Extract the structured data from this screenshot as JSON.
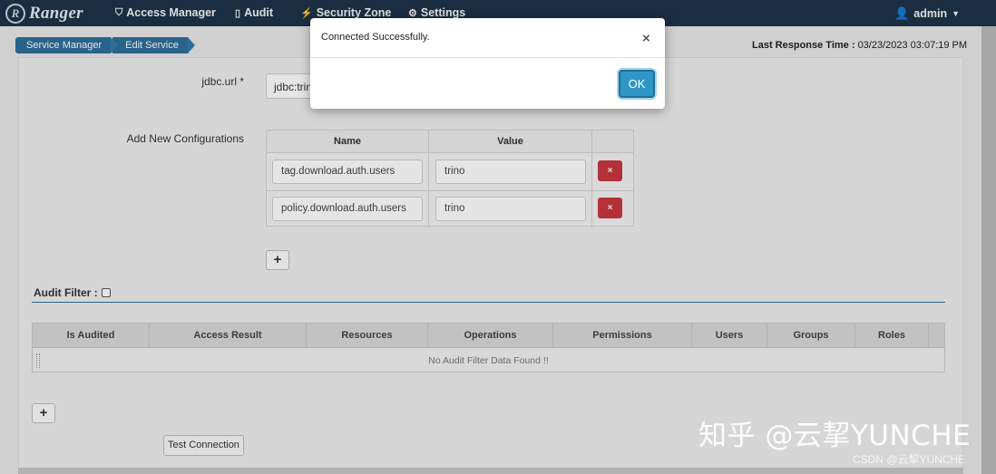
{
  "navbar": {
    "brand": "Ranger",
    "brand_logo": "R",
    "items": [
      {
        "label": "Access Manager",
        "icon": "shield-icon"
      },
      {
        "label": "Audit",
        "icon": "file-icon"
      },
      {
        "label": "Security Zone",
        "icon": "bolt-icon"
      },
      {
        "label": "Settings",
        "icon": "gear-icon"
      }
    ],
    "user": {
      "label": "admin",
      "icon": "user-icon"
    }
  },
  "breadcrumb": [
    "Service Manager",
    "Edit Service"
  ],
  "last_response": {
    "label": "Last Response Time :",
    "value": "03/23/2023 03:07:19 PM"
  },
  "form": {
    "jdbc_label": "jdbc.url *",
    "jdbc_value": "jdbc:trin",
    "add_config_label": "Add New Configurations",
    "config_headers": [
      "Name",
      "Value"
    ],
    "config_rows": [
      {
        "name": "tag.download.auth.users",
        "value": "trino"
      },
      {
        "name": "policy.download.auth.users",
        "value": "trino"
      }
    ],
    "delete_glyph": "×",
    "plus_glyph": "+"
  },
  "audit": {
    "title": "Audit Filter :",
    "columns": [
      "Is Audited",
      "Access Result",
      "Resources",
      "Operations",
      "Permissions",
      "Users",
      "Groups",
      "Roles"
    ],
    "empty_message": "No Audit Filter Data Found !!"
  },
  "test_connection_label": "Test Connection",
  "modal": {
    "message": "Connected Successfully.",
    "close_glyph": "×",
    "ok_label": "OK"
  },
  "watermark": {
    "big": "知乎 @云挈YUNCHE",
    "small": "CSDN @云挈YUNCHE"
  },
  "colors": {
    "navbar": "#1f3348",
    "breadcrumb": "#2e6f9a",
    "delete": "#c9373f",
    "ok": "#2f97c8"
  }
}
